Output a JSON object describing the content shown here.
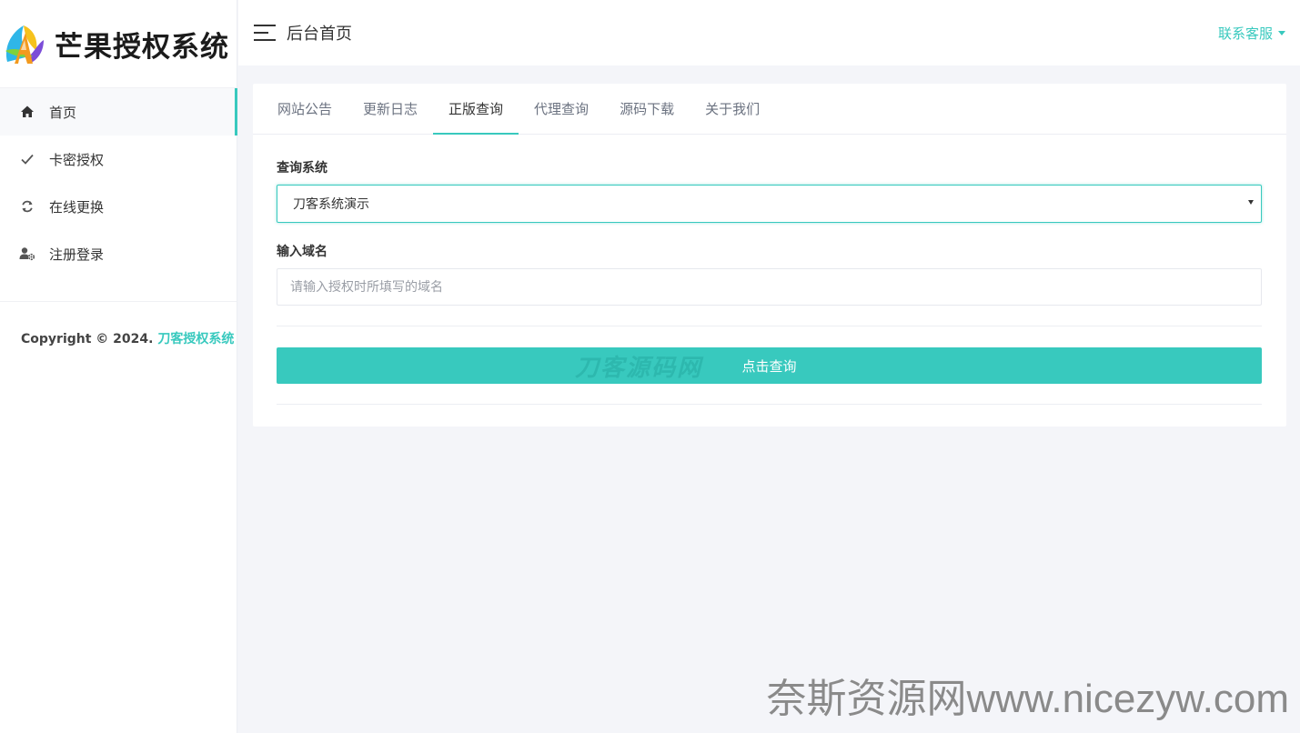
{
  "brand": {
    "title": "芒果授权系统"
  },
  "sidebar": {
    "items": [
      {
        "label": "首页",
        "icon": "home-icon",
        "active": true
      },
      {
        "label": "卡密授权",
        "icon": "check-icon",
        "active": false
      },
      {
        "label": "在线更换",
        "icon": "refresh-icon",
        "active": false
      },
      {
        "label": "注册登录",
        "icon": "user-gear-icon",
        "active": false
      }
    ],
    "copyright_prefix": "Copyright © 2024.",
    "copyright_link": "刀客授权系统"
  },
  "header": {
    "title": "后台首页",
    "contact": "联系客服"
  },
  "tabs": [
    {
      "label": "网站公告",
      "active": false
    },
    {
      "label": "更新日志",
      "active": false
    },
    {
      "label": "正版查询",
      "active": true
    },
    {
      "label": "代理查询",
      "active": false
    },
    {
      "label": "源码下载",
      "active": false
    },
    {
      "label": "关于我们",
      "active": false
    }
  ],
  "form": {
    "system_label": "查询系统",
    "system_value": "刀客系统演示",
    "domain_label": "输入域名",
    "domain_placeholder": "请输入授权时所填写的域名",
    "submit_label": "点击查询"
  },
  "watermarks": {
    "button_overlay": "刀客源码网",
    "site": "奈斯资源网www.nicezyw.com"
  },
  "colors": {
    "accent": "#38c9be",
    "background": "#f4f5f9"
  }
}
